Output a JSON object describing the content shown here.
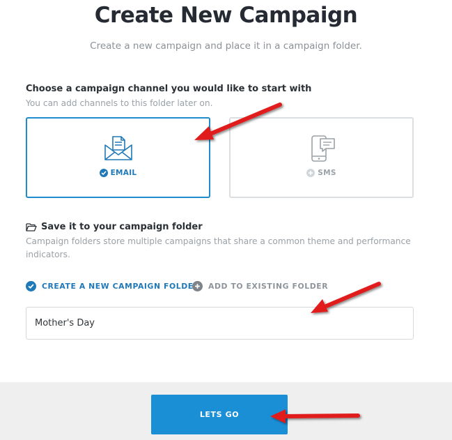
{
  "header": {
    "title": "Create New Campaign",
    "subtitle": "Create a new campaign and place it in a campaign folder."
  },
  "channel_section": {
    "heading": "Choose a campaign channel you would like to start with",
    "description": "You can add channels to this folder later on.",
    "channels": [
      {
        "label": "EMAIL",
        "icon": "email-envelope-icon",
        "selected": true
      },
      {
        "label": "SMS",
        "icon": "phone-chat-icon",
        "selected": false
      }
    ]
  },
  "folder_section": {
    "heading": "Save it to your campaign folder",
    "description_line1": "Campaign folders store multiple campaigns that share a common theme and performance",
    "description_line2": "indicators.",
    "options": [
      {
        "label": "CREATE A NEW CAMPAIGN FOLDER",
        "selected": true
      },
      {
        "label": "ADD TO EXISTING FOLDER",
        "selected": false
      }
    ],
    "folder_name_value": "Mother's Day"
  },
  "footer": {
    "go_label": "LETS GO"
  },
  "colors": {
    "accent": "#1f78b8",
    "button": "#1b8fd6",
    "annotation_arrow": "#e01b1b"
  }
}
